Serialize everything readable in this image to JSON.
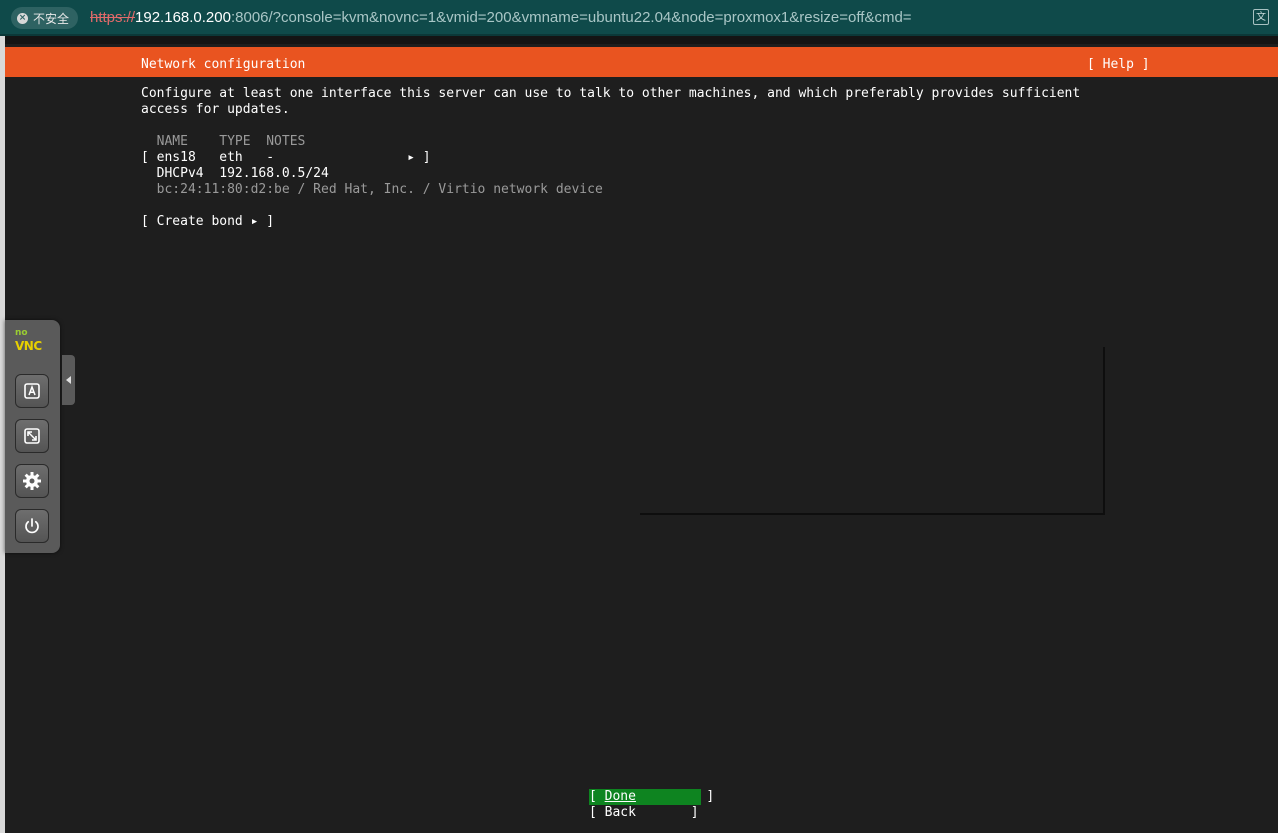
{
  "browser": {
    "security_label": "不安全",
    "url_scheme": "https://",
    "url_host": "192.168.0.200",
    "url_rest": ":8006/?console=kvm&novnc=1&vmid=200&vmname=ubuntu22.04&node=proxmox1&resize=off&cmd="
  },
  "installer": {
    "title": "Network configuration",
    "help_label": "[ Help ]",
    "intro_line1": "Configure at least one interface this server can use to talk to other machines, and which preferably provides sufficient",
    "intro_line2": "access for updates.",
    "table_header": "  NAME    TYPE  NOTES",
    "interface_row": "[ ens18   eth   -                 ▸ ]",
    "dhcp_row": "  DHCPv4  192.168.0.5/24",
    "device_row": "  bc:24:11:80:d2:be / Red Hat, Inc. / Virtio network device",
    "create_bond": "[ Create bond ▸ ]",
    "done_open": "[ ",
    "done_label": "Done",
    "done_close": "         ]",
    "back_label": "[ Back       ]"
  },
  "novnc": {
    "logo_no": "no",
    "logo_vnc": "VNC",
    "icons": [
      "keyboard-icon",
      "fullscreen-icon",
      "settings-gear-icon",
      "power-icon"
    ]
  },
  "colors": {
    "header_orange": "#e95420",
    "done_green": "#0e8420",
    "console_bg": "#1e1e1e",
    "browser_bar": "#0f4a4a"
  }
}
